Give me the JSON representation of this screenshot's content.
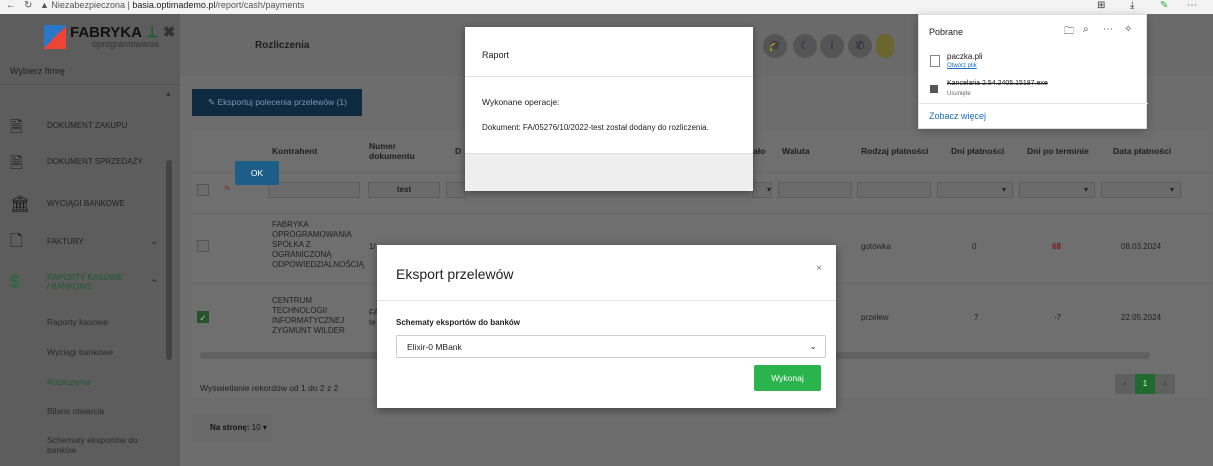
{
  "browser": {
    "insecure_label": "Niezabezpieczona",
    "url_host": "basia.optimademo.pl",
    "url_path": "/report/cash/payments"
  },
  "sidebar": {
    "logo_title": "FABRYKA",
    "logo_subtitle": "oprogramowania",
    "firm_placeholder": "Wybierz firmę",
    "items": [
      {
        "label": "DOKUMENT ZAKUPU",
        "icon": "document-icon"
      },
      {
        "label": "DOKUMENT SPRZEDAŻY",
        "icon": "document-icon"
      },
      {
        "label": "WYCIĄGI BANKOWE",
        "icon": "bank-icon"
      },
      {
        "label": "FAKTURY",
        "icon": "file-icon"
      },
      {
        "label": "RAPORTY KASOWE / BANKOWE",
        "icon": "dollar-icon"
      }
    ],
    "subitems": [
      "Raporty kasowe",
      "Wyciągi bankowe",
      "Rozliczenia",
      "Bilans otwarcia",
      "Schematy eksportów do banków"
    ]
  },
  "header": {
    "title": "Rozliczenia"
  },
  "toolbar": {
    "export_label": "Eksportuj polecenia przelewów (1)"
  },
  "table": {
    "headers": {
      "contractor": "Kontrahent",
      "doc_number": "Numer dokumentu",
      "d": "D",
      "paid_partial": "ało",
      "currency": "Waluta",
      "payment_type": "Rodzaj płatności",
      "days_payment": "Dni płatności",
      "days_overdue": "Dni po terminie",
      "payment_date": "Data płatności"
    },
    "filter_doc": "test",
    "rows": [
      {
        "checked": false,
        "contractor": "FABRYKA OPROGRAMOWANIA SPÓŁKA Z OGRANICZONĄ ODPOWIEDZIALNOŚCIĄ",
        "doc_number": "1/",
        "payment_type": "gotówka",
        "days_payment": "0",
        "days_overdue": "68",
        "payment_date": "08.03.2024"
      },
      {
        "checked": true,
        "contractor": "CENTRUM TECHNOLOGII INFORMATYCZNEJ ZYGMUNT WILDER",
        "doc_number": "FA",
        "doc_number2": "te",
        "payment_type": "przelew",
        "days_payment": "7",
        "days_overdue": "-7",
        "payment_date": "22.05.2024"
      }
    ],
    "status": "Wyświetlanie rekordów od 1 do 2 z 2",
    "page_current": "1",
    "per_page_label": "Na stronę:",
    "per_page_value": "10"
  },
  "raport_modal": {
    "title": "Raport",
    "line1": "Wykonane operacje:",
    "line2": "Dokument: FA/05276/10/2022-test został dodany do rozliczenia.",
    "ok_label": "OK"
  },
  "export_modal": {
    "title": "Eksport przelewów",
    "close": "×",
    "field_label": "Schematy eksportów do banków",
    "selected": "Elixir-0 MBank",
    "submit_label": "Wykonaj"
  },
  "downloads": {
    "title": "Pobrane",
    "items": [
      {
        "name": "paczka.pli",
        "sub": "Otwórz plik",
        "removed": false
      },
      {
        "name": "Kancelaria 2.54.2405.15187.exe",
        "sub": "Usunięte",
        "removed": true
      }
    ],
    "see_more": "Zobacz więcej"
  }
}
